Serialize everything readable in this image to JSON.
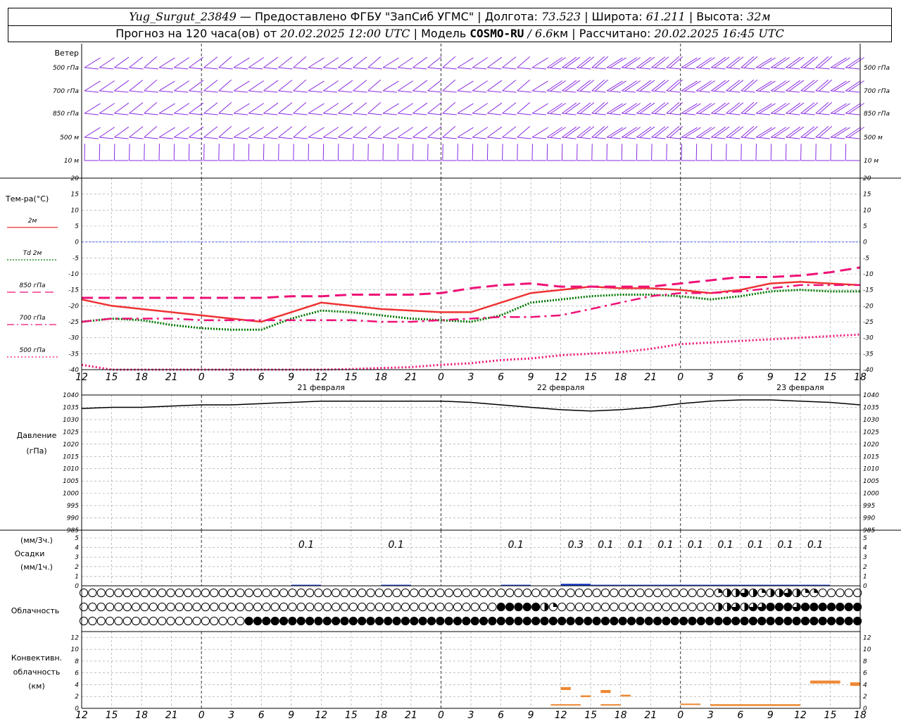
{
  "header": {
    "station": "Yug_Surgut_23849",
    "provider": "— Предоставлено ФГБУ \"ЗапСиб УГМС\" |",
    "lon_label": "Долгота:",
    "lon_value": "73.523",
    "lat_label": "| Широта:",
    "lat_value": "61.211",
    "alt_label": "| Высота:",
    "alt_value": "32м",
    "forecast_label": "Прогноз на 120 часа(ов) от",
    "forecast_time": "20.02.2025 12:00 UTC",
    "model_label": "| Модель",
    "model_name": "COSMO-RU",
    "model_res": "/ 6.6",
    "model_res_unit": "км",
    "calc_label": "| Рассчитано:",
    "calc_time": "20.02.2025 16:45 UTC"
  },
  "panels": {
    "wind": {
      "title": "Ветер",
      "levels": [
        "500 гПа",
        "700 гПа",
        "850 гПа",
        "500 м",
        "10  м"
      ]
    },
    "temperature": {
      "title": "Тем-ра(°C)",
      "legend": [
        {
          "label": "2м",
          "color": "#ee3333",
          "dash": ""
        },
        {
          "label": "Td  2м",
          "color": "#007700",
          "dash": "2,2"
        },
        {
          "label": "850 гПа",
          "color": "#ee1177",
          "dash": "12,6"
        },
        {
          "label": "700 гПа",
          "color": "#ee1177",
          "dash": "10,4,2,4"
        },
        {
          "label": "500 гПа",
          "color": "#ee1177",
          "dash": "2,3"
        }
      ],
      "ticks": [
        "20",
        "15",
        "10",
        "5",
        "0",
        "-5",
        "-10",
        "-15",
        "-20",
        "-25",
        "-30",
        "-35",
        "-40"
      ]
    },
    "pressure": {
      "title": "Давление",
      "unit": "(гПа)",
      "ticks": [
        "1040",
        "1035",
        "1030",
        "1025",
        "1020",
        "1015",
        "1010",
        "1005",
        "1000",
        "995",
        "990",
        "985"
      ]
    },
    "precip": {
      "label_top": "(мм/3ч.)",
      "title": "Осадки",
      "label_bottom": "(мм/1ч.)",
      "ticks": [
        "5",
        "4",
        "3",
        "2",
        "1",
        "0"
      ],
      "amounts": [
        {
          "hour": 24,
          "text": "0.1"
        },
        {
          "hour": 33,
          "text": "0.1"
        },
        {
          "hour": 45,
          "text": "0.1"
        },
        {
          "hour": 51,
          "text": "0.3"
        },
        {
          "hour": 54,
          "text": "0.1"
        },
        {
          "hour": 57,
          "text": "0.1"
        },
        {
          "hour": 60,
          "text": "0.1"
        },
        {
          "hour": 63,
          "text": "0.1"
        },
        {
          "hour": 66,
          "text": "0.1"
        },
        {
          "hour": 69,
          "text": "0.1"
        },
        {
          "hour": 72,
          "text": "0.1"
        },
        {
          "hour": 75,
          "text": "0.1"
        }
      ]
    },
    "clouds": {
      "title": "Облачность"
    },
    "convective": {
      "title1": "Конвективн.",
      "title2": "облачность",
      "unit": "(км)",
      "ticks": [
        "12",
        "10",
        "8",
        "6",
        "4",
        "2",
        "0"
      ]
    }
  },
  "time_axis": {
    "labels": [
      "12",
      "15",
      "18",
      "21",
      "0",
      "3",
      "6",
      "9",
      "12",
      "15",
      "18",
      "21",
      "0",
      "3",
      "6",
      "9",
      "12",
      "15",
      "18",
      "21",
      "0",
      "3",
      "6",
      "9",
      "12",
      "15",
      "18"
    ],
    "dates": [
      "21 февраля",
      "22 февраля",
      "23 февраля"
    ]
  },
  "chart_data": {
    "type": "line",
    "x_unit": "hours since 20.02.2025 12:00 UTC",
    "temperature_series": [
      {
        "name": "2м",
        "x": [
          0,
          3,
          6,
          9,
          12,
          15,
          18,
          21,
          24,
          27,
          30,
          33,
          36,
          39,
          42,
          45,
          48,
          51,
          54,
          57,
          60,
          63,
          66,
          69,
          72,
          75,
          78
        ],
        "values": [
          -18,
          -20,
          -21,
          -22,
          -23,
          -24,
          -25,
          -22,
          -19,
          -20,
          -21,
          -21.5,
          -22,
          -22,
          -19,
          -16,
          -15,
          -14,
          -14.5,
          -14.5,
          -15,
          -16,
          -15,
          -13,
          -12.5,
          -13,
          -13.5
        ]
      },
      {
        "name": "Td  2м",
        "x": [
          0,
          3,
          6,
          9,
          12,
          15,
          18,
          21,
          24,
          27,
          30,
          33,
          36,
          39,
          42,
          45,
          48,
          51,
          54,
          57,
          60,
          63,
          66,
          69,
          72,
          75,
          78
        ],
        "values": [
          -25,
          -24,
          -24.5,
          -26,
          -27,
          -27.5,
          -27.5,
          -24,
          -21.5,
          -22,
          -23,
          -24,
          -24.5,
          -25,
          -23,
          -19,
          -18,
          -17,
          -16.5,
          -16.5,
          -17,
          -18,
          -17,
          -15.5,
          -15,
          -15.5,
          -15.5
        ]
      },
      {
        "name": "850 гПа",
        "x": [
          0,
          3,
          6,
          9,
          12,
          15,
          18,
          21,
          24,
          27,
          30,
          33,
          36,
          39,
          42,
          45,
          48,
          51,
          54,
          57,
          60,
          63,
          66,
          69,
          72,
          75,
          78
        ],
        "values": [
          -17.5,
          -17.5,
          -17.5,
          -17.5,
          -17.5,
          -17.5,
          -17.5,
          -17,
          -17,
          -16.5,
          -16.5,
          -16.5,
          -16,
          -14.5,
          -13.5,
          -13,
          -14,
          -14,
          -14,
          -14,
          -13,
          -12,
          -11,
          -11,
          -10.5,
          -9.5,
          -8
        ]
      },
      {
        "name": "700 гПа",
        "x": [
          0,
          3,
          6,
          9,
          12,
          15,
          18,
          21,
          24,
          27,
          30,
          33,
          36,
          39,
          42,
          45,
          48,
          51,
          54,
          57,
          60,
          63,
          66,
          69,
          72,
          75,
          78
        ],
        "values": [
          -25,
          -24,
          -24,
          -24,
          -24.5,
          -24.5,
          -24.5,
          -24.5,
          -24.5,
          -24.5,
          -25,
          -25,
          -24.5,
          -24,
          -23.5,
          -23.5,
          -23,
          -21,
          -19,
          -17,
          -16,
          -16,
          -15.5,
          -14.5,
          -13.5,
          -13.5,
          -13.5
        ]
      },
      {
        "name": "500 гПа",
        "x": [
          0,
          3,
          6,
          9,
          12,
          15,
          18,
          21,
          24,
          27,
          30,
          33,
          36,
          39,
          42,
          45,
          48,
          51,
          54,
          57,
          60,
          63,
          66,
          69,
          72,
          75,
          78
        ],
        "values": [
          -38.5,
          -40,
          -41,
          -41,
          -41,
          -41,
          -41,
          -41,
          -40,
          -39.8,
          -39.5,
          -39.2,
          -38.5,
          -38,
          -37,
          -36.5,
          -35.5,
          -35,
          -34.5,
          -33.5,
          -32,
          -31.5,
          -31,
          -30.5,
          -30,
          -29.5,
          -29
        ]
      }
    ],
    "pressure_series": {
      "name": "Давление",
      "x": [
        0,
        3,
        6,
        9,
        12,
        15,
        18,
        21,
        24,
        27,
        30,
        33,
        36,
        39,
        42,
        45,
        48,
        51,
        54,
        57,
        60,
        63,
        66,
        69,
        72,
        75,
        78
      ],
      "values": [
        1034.5,
        1035,
        1035,
        1035.5,
        1036,
        1036,
        1036.5,
        1037,
        1037.5,
        1037.5,
        1037.5,
        1037.5,
        1037.5,
        1037,
        1036,
        1035,
        1034,
        1033.5,
        1034,
        1035,
        1036.5,
        1037.5,
        1038,
        1038,
        1037.5,
        1037,
        1036
      ]
    },
    "temperature_ylim": [
      -40,
      20
    ],
    "pressure_ylim": [
      985,
      1040
    ],
    "precip_ylim": [
      0,
      5
    ],
    "convective_ylim": [
      0,
      13
    ],
    "xlim": [
      0,
      78
    ],
    "grid": true,
    "cloud_cover_rows": {
      "upper": [
        0,
        0,
        0,
        0,
        0,
        0,
        0,
        0,
        0,
        0,
        0,
        0,
        0,
        0,
        0,
        0,
        0,
        0,
        0,
        0,
        0,
        0,
        0,
        0,
        0,
        0,
        0,
        0,
        0,
        0,
        0,
        0,
        0,
        0,
        0,
        0,
        0,
        0,
        0,
        0,
        0,
        0,
        0,
        0,
        0,
        0,
        0,
        0,
        0,
        0,
        0,
        0,
        0,
        0,
        0,
        0,
        0,
        0,
        0,
        0,
        0,
        0,
        0,
        0,
        0,
        0,
        0,
        0,
        0,
        0,
        0,
        0,
        0,
        0.25,
        0.5,
        0.5,
        0.75,
        0.5,
        0.25,
        0.5,
        0.5,
        0.75,
        0.5,
        0.25,
        0.25,
        0,
        0,
        0,
        0,
        0
      ],
      "middle": [
        0,
        0,
        0,
        0,
        0,
        0,
        0,
        0,
        0,
        0,
        0,
        0,
        0,
        0,
        0,
        0,
        0,
        0,
        0,
        0,
        0,
        0,
        0,
        0,
        0,
        0,
        0,
        0,
        0,
        0,
        0,
        0,
        0,
        0,
        0,
        0,
        0,
        0,
        0,
        0,
        0,
        0,
        0,
        0,
        0,
        0,
        0,
        0,
        1,
        1,
        1,
        1,
        1,
        0.5,
        0.25,
        0,
        0,
        0,
        0,
        0,
        0,
        0,
        0,
        0,
        0,
        0,
        0,
        0,
        0,
        0,
        0,
        0,
        0,
        0.5,
        0.5,
        0.75,
        0.5,
        0.75,
        0.75,
        1,
        1,
        1,
        0.75,
        1,
        1,
        1,
        1,
        1,
        1,
        1
      ],
      "lower": [
        0,
        0,
        0,
        0,
        0,
        0,
        0,
        0,
        0,
        0,
        0,
        0,
        0,
        0,
        0,
        0,
        0,
        0,
        0,
        1,
        1,
        1,
        1,
        1,
        1,
        1,
        1,
        1,
        1,
        1,
        1,
        1,
        1,
        1,
        1,
        1,
        1,
        1,
        1,
        1,
        1,
        1,
        1,
        1,
        1,
        1,
        1,
        1,
        1,
        1,
        1,
        1,
        1,
        1,
        1,
        1,
        1,
        1,
        1,
        1,
        1,
        1,
        1,
        1,
        1,
        1,
        1,
        1,
        1,
        1,
        1,
        1,
        1,
        1,
        1,
        1,
        1,
        1,
        1,
        1,
        1,
        1,
        1,
        1,
        1,
        1,
        1,
        1,
        1,
        1
      ]
    }
  }
}
